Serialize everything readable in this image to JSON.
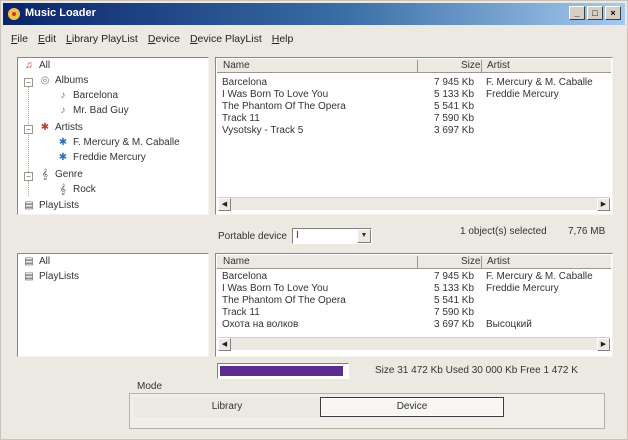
{
  "window": {
    "title": "Music Loader",
    "controls": [
      "_",
      "□",
      "×"
    ]
  },
  "menu": [
    "File",
    "Edit",
    "Library PlayList",
    "Device",
    "Device PlayList",
    "Help"
  ],
  "top_tree": {
    "all": "All",
    "albums": "Albums",
    "album_items": [
      "Barcelona",
      "Mr. Bad Guy"
    ],
    "artists": "Artists",
    "artist_items": [
      "F. Mercury & M. Caballe",
      "Freddie Mercury"
    ],
    "genre": "Genre",
    "genre_items": [
      "Rock"
    ],
    "playlists": "PlayLists"
  },
  "columns": {
    "name": "Name",
    "size": "Size",
    "artist": "Artist"
  },
  "top_list": [
    {
      "name": "Barcelona",
      "size": "7 945 Kb",
      "artist": "F. Mercury & M. Caballe"
    },
    {
      "name": "I Was Born To Love You",
      "size": "5 133 Kb",
      "artist": "Freddie Mercury"
    },
    {
      "name": "The Phantom Of The Opera",
      "size": "5 541 Kb",
      "artist": ""
    },
    {
      "name": "Track 11",
      "size": "7 590 Kb",
      "artist": ""
    },
    {
      "name": "Vysotsky - Track  5",
      "size": "3 697 Kb",
      "artist": ""
    }
  ],
  "portable_device": {
    "label": "Portable device",
    "value": "I"
  },
  "selection_status": {
    "count": "1  object(s) selected",
    "size": "7,76  MB"
  },
  "bottom_tree": {
    "all": "All",
    "playlists": "PlayLists"
  },
  "bottom_list": [
    {
      "name": "Barcelona",
      "size": "7 945 Kb",
      "artist": "F. Mercury & M. Caballe"
    },
    {
      "name": "I Was Born To Love You",
      "size": "5 133 Kb",
      "artist": "Freddie Mercury"
    },
    {
      "name": "The Phantom Of The Opera",
      "size": "5 541 Kb",
      "artist": ""
    },
    {
      "name": "Track 11",
      "size": "7 590 Kb",
      "artist": ""
    },
    {
      "name": "Охота на волков",
      "size": "3 697 Kb",
      "artist": "Высоцкий"
    }
  ],
  "storage": {
    "used_fraction": 0.98,
    "text": "Size  31 472 Kb   Used  30 000 Kb   Free  1 472 K"
  },
  "mode": {
    "label": "Mode",
    "library": "Library",
    "device": "Device"
  },
  "colors": {
    "progress": "#5b2d91",
    "titlebar": "#0a246a"
  }
}
